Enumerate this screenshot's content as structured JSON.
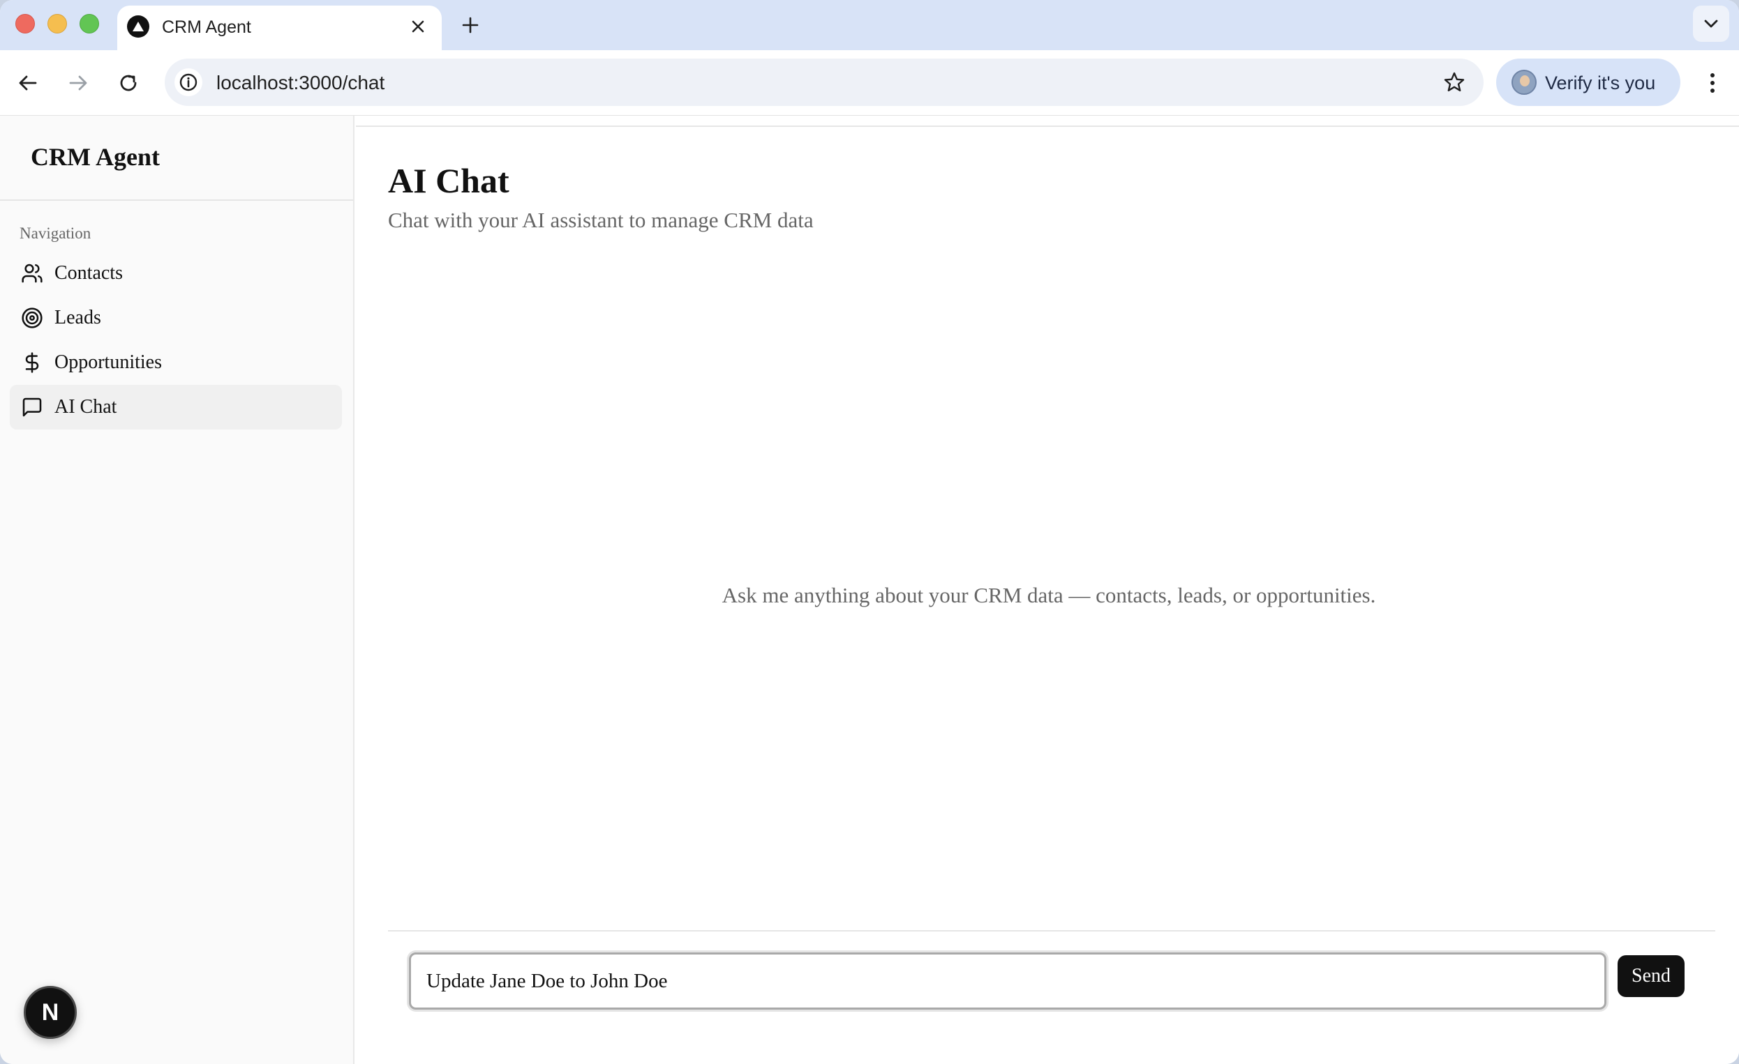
{
  "browser": {
    "tab_title": "CRM Agent",
    "url": "localhost:3000/chat",
    "profile_label": "Verify it's you"
  },
  "sidebar": {
    "brand": "CRM Agent",
    "heading": "Navigation",
    "items": [
      {
        "label": "Contacts",
        "icon": "users-icon",
        "active": false
      },
      {
        "label": "Leads",
        "icon": "target-icon",
        "active": false
      },
      {
        "label": "Opportunities",
        "icon": "dollar-icon",
        "active": false
      },
      {
        "label": "AI Chat",
        "icon": "message-square-icon",
        "active": true
      }
    ],
    "dev_badge": "N"
  },
  "main": {
    "title": "AI Chat",
    "subtitle": "Chat with your AI assistant to manage CRM data",
    "empty_hint": "Ask me anything about your CRM data — contacts, leads, or opportunities.",
    "input_value": "Update Jane Doe to John Doe",
    "send_label": "Send"
  },
  "colors": {
    "tabstrip": "#d8e3f7",
    "accent_dark": "#111111",
    "muted_text": "#666666",
    "active_nav_bg": "#f0f0f0"
  }
}
